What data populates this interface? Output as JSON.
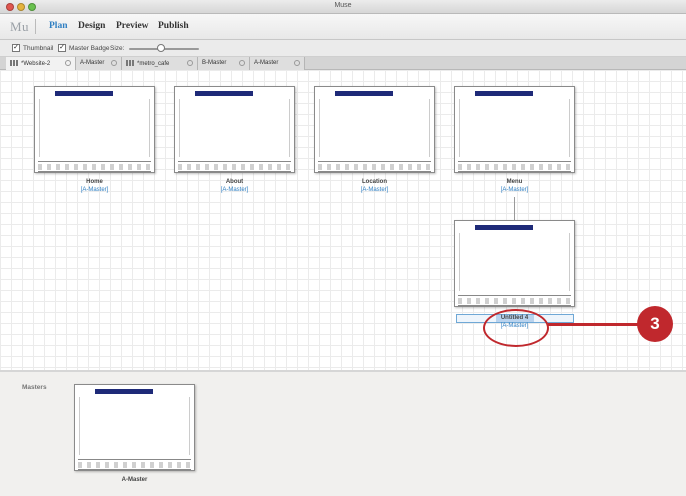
{
  "window": {
    "title": "Muse"
  },
  "menubar": {
    "logo": "Mu",
    "items": [
      "Plan",
      "Design",
      "Preview",
      "Publish"
    ]
  },
  "options": {
    "thumbnail_label": "Thumbnail",
    "master_badge_label": "Master Badge",
    "size_label": "Size:",
    "thumbnail_checked": true,
    "master_badge_checked": true,
    "size_level": 0.45
  },
  "tabs": [
    "*Website-2",
    "A-Master",
    "*metro_cafe",
    "B-Master",
    "A-Master"
  ],
  "pages": [
    {
      "name": "Home",
      "master": "[A-Master]"
    },
    {
      "name": "About",
      "master": "[A-Master]"
    },
    {
      "name": "Location",
      "master": "[A-Master]"
    },
    {
      "name": "Menu",
      "master": "[A-Master]"
    },
    {
      "name": "Untitled 4",
      "master": "[A-Master]"
    }
  ],
  "masters_section": {
    "label": "Masters",
    "items": [
      {
        "name": "A-Master"
      }
    ]
  },
  "callout": {
    "number": "3"
  },
  "colors": {
    "accent": "#2f7fc2",
    "callout_red": "#c0282d",
    "menu_bar_navy": "#1e2a78"
  }
}
